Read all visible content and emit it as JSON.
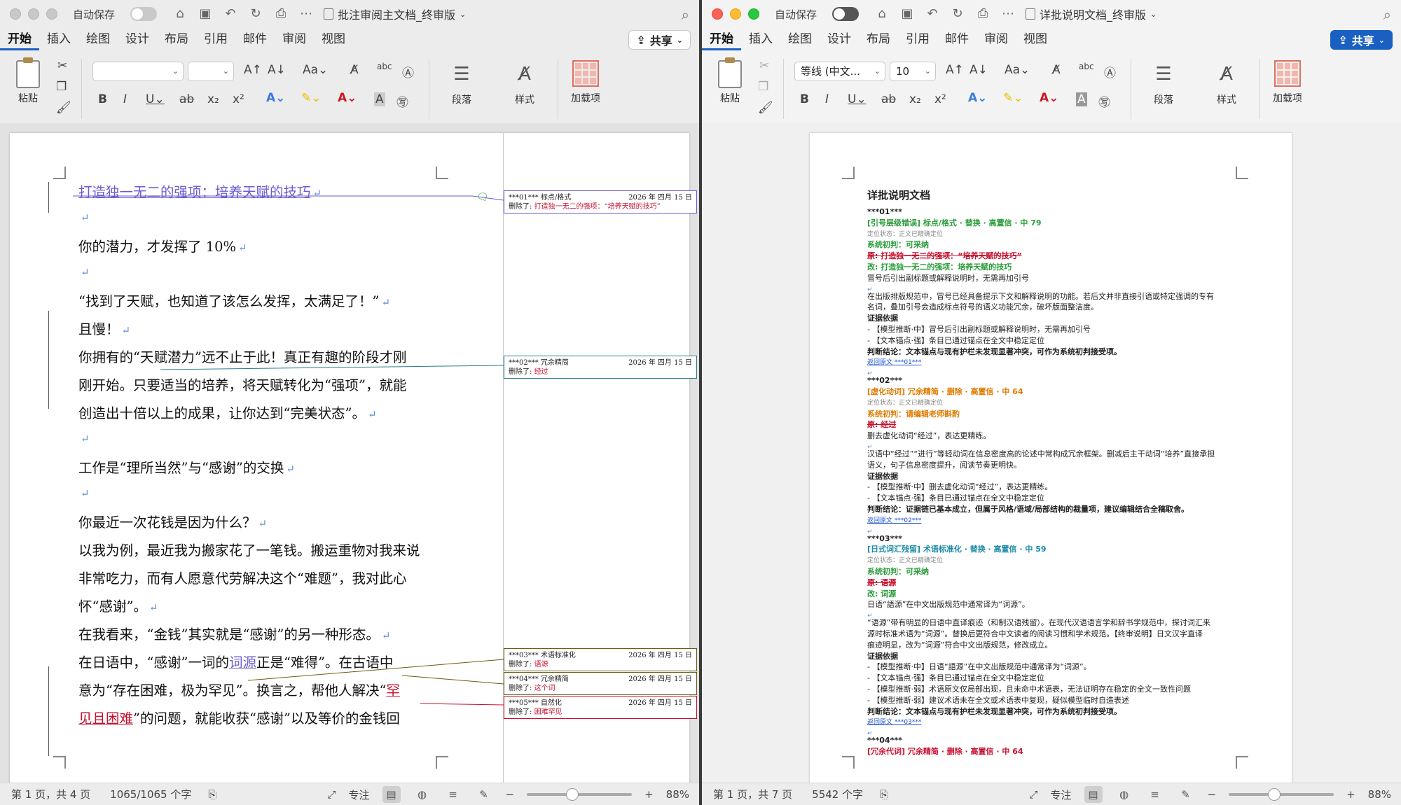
{
  "left": {
    "autosave_label": "自动保存",
    "title": "批注审阅主文档_终审版",
    "tabs": [
      "开始",
      "插入",
      "绘图",
      "设计",
      "布局",
      "引用",
      "邮件",
      "审阅",
      "视图"
    ],
    "share_label": "共享",
    "ribbon": {
      "paste": "粘贴",
      "paragraph": "段落",
      "styles": "样式",
      "addins": "加载项",
      "font_name": "",
      "font_size": ""
    },
    "paragraphs": [
      {
        "text": "打造独一无二的强项：培养天赋的技巧",
        "style": "ins"
      },
      {
        "text": ""
      },
      {
        "text": "你的潜力，才发挥了 10%"
      },
      {
        "text": ""
      },
      {
        "text": "“找到了天赋，也知道了该怎么发挥，太满足了！”"
      },
      {
        "text": "且慢！"
      },
      {
        "text": "你拥有的“天赋潜力”远不止于此！真正有趣的阶段才刚"
      },
      {
        "text": "刚开始。只要适当的培养，将天赋转化为“强项”，就能"
      },
      {
        "text": "创造出十倍以上的成果，让你达到“完美状态”。"
      },
      {
        "text": ""
      },
      {
        "text": "工作是“理所当然”与“感谢”的交换"
      },
      {
        "text": ""
      },
      {
        "text": "你最近一次花钱是因为什么？"
      },
      {
        "text": "以我为例，最近我为搬家花了一笔钱。搬运重物对我来说"
      },
      {
        "text": "非常吃力，而有人愿意代劳解决这个“难题”，我对此心"
      },
      {
        "text": "怀“感谢”。"
      },
      {
        "text": "在我看来，“金钱”其实就是“感谢”的另一种形态。"
      }
    ],
    "para_line17_a": "在日语中，“感谢”一词的",
    "para_line17_b": "词源",
    "para_line17_c": "正是“难得”。在古语中",
    "para_line18_a": "意为“存在困难，极为罕见”。换言之，帮他人解决“",
    "para_line18_b": "罕",
    "para_line19_a": "见且困难",
    "para_line19_b": "”的问题，就能收获“感谢”以及等价的金钱回",
    "comments": [
      {
        "id": "***01***",
        "type": "标点/格式",
        "date": "2026 年 四月 15 日",
        "deleted": "打造独一无二的强项：“培养天赋的技巧”"
      },
      {
        "id": "***02***",
        "type": "冗余精简",
        "date": "2026 年 四月 15 日",
        "deleted": "经过"
      },
      {
        "id": "***03***",
        "type": "术语标准化",
        "date": "2026 年 四月 15 日",
        "deleted": "语源"
      },
      {
        "id": "***04***",
        "type": "冗余精简",
        "date": "2026 年 四月 15 日",
        "deleted": "这个词"
      },
      {
        "id": "***05***",
        "type": "自然化",
        "date": "2026 年 四月 15 日",
        "deleted": "困难罕见"
      }
    ],
    "deleted_label": "删除了:",
    "status": {
      "page": "第 1 页，共 4 页",
      "words": "1065/1065 个字",
      "focus": "专注",
      "zoom": "88%"
    }
  },
  "right": {
    "autosave_label": "自动保存",
    "title": "详批说明文档_终审版",
    "tabs": [
      "开始",
      "插入",
      "绘图",
      "设计",
      "布局",
      "引用",
      "邮件",
      "审阅",
      "视图"
    ],
    "share_label": "共享",
    "ribbon": {
      "paste": "粘贴",
      "paragraph": "段落",
      "styles": "样式",
      "addins": "加载项",
      "font_name": "等线 (中文...",
      "font_size": "10"
    },
    "doc_title": "详批说明文档",
    "lines": [
      {
        "t": "***01***",
        "c": "bold"
      },
      {
        "t": "[引号层级错误] 标点/格式 · 替换 · 高置信 · 中 79",
        "c": "tag-g"
      },
      {
        "t": "定位状态：正文已精确定位",
        "c": "dim"
      },
      {
        "t": "系统初判：可采纳",
        "c": "g-bold"
      },
      {
        "t": "原: 打造独一无二的强项：“培养天赋的技巧”",
        "c": "orig-r"
      },
      {
        "t": "改: 打造独一无二的强项：培养天赋的技巧",
        "c": "new-g"
      },
      {
        "t": "冒号后引出副标题或解释说明时，无需再加引号",
        "c": ""
      },
      {
        "t": "",
        "c": ""
      },
      {
        "t": "在出版排版规范中，冒号已经具备提示下文和解释说明的功能。若后文并非直接引语或特定强调的专有",
        "c": ""
      },
      {
        "t": "名词，叠加引号会造成标点符号的语义功能冗余，破坏版面整洁度。",
        "c": ""
      },
      {
        "t": "证据依据",
        "c": "bold"
      },
      {
        "t": "- 【模型推断·中】冒号后引出副标题或解释说明时，无需再加引号",
        "c": ""
      },
      {
        "t": "- 【文本锚点·强】条目已通过锚点在全文中稳定定位",
        "c": ""
      },
      {
        "t": "判断结论：文本锚点与现有护栏未发现显著冲突，可作为系统初判接受项。",
        "c": "bold-lead"
      },
      {
        "t": "返回原文 ***01***",
        "c": "link"
      },
      {
        "t": "",
        "c": ""
      },
      {
        "t": "***02***",
        "c": "bold"
      },
      {
        "t": "[虚化动词] 冗余精简 · 删除 · 高置信 · 中 64",
        "c": "tag-o"
      },
      {
        "t": "定位状态：正文已精确定位",
        "c": "dim"
      },
      {
        "t": "系统初判：请编辑老师斟酌",
        "c": "o-bold"
      },
      {
        "t": "原: 经过",
        "c": "orig-r"
      },
      {
        "t": "删去虚化动词“经过”，表达更精练。",
        "c": ""
      },
      {
        "t": "",
        "c": ""
      },
      {
        "t": "汉语中“经过”“进行”等轻动词在信息密度高的论述中常构成冗余框架。删减后主干动词“培养”直接承担",
        "c": ""
      },
      {
        "t": "语义，句子信息密度提升，阅读节奏更明快。",
        "c": ""
      },
      {
        "t": "证据依据",
        "c": "bold"
      },
      {
        "t": "- 【模型推断·中】删去虚化动词“经过”，表达更精练。",
        "c": ""
      },
      {
        "t": "- 【文本锚点·强】条目已通过锚点在全文中稳定定位",
        "c": ""
      },
      {
        "t": "判断结论：证据链已基本成立，但属于风格/语域/局部结构的裁量项，建议编辑结合全稿取舍。",
        "c": "bold-lead"
      },
      {
        "t": "返回原文 ***02***",
        "c": "link"
      },
      {
        "t": "",
        "c": ""
      },
      {
        "t": "***03***",
        "c": "bold"
      },
      {
        "t": "[日式词汇残留] 术语标准化 · 替换 · 高置信 · 中 59",
        "c": "tag-b"
      },
      {
        "t": "定位状态：正文已精确定位",
        "c": "dim"
      },
      {
        "t": "系统初判：可采纳",
        "c": "g-bold"
      },
      {
        "t": "原: 语源",
        "c": "orig-r"
      },
      {
        "t": "改: 词源",
        "c": "new-g"
      },
      {
        "t": "日语“語源”在中文出版规范中通常译为“词源”。",
        "c": ""
      },
      {
        "t": "",
        "c": ""
      },
      {
        "t": "“语源”带有明显的日语中直译痕迹（和制汉语残留）。在现代汉语语言学和辞书学规范中，探讨词汇来",
        "c": ""
      },
      {
        "t": "源时标准术语为“词源”。替换后更符合中文读者的阅读习惯和学术规范。【终审说明】日文汉字直译",
        "c": ""
      },
      {
        "t": "痕迹明显，改为“词源”符合中文出版规范，修改成立。",
        "c": ""
      },
      {
        "t": "证据依据",
        "c": "bold"
      },
      {
        "t": "- 【模型推断·中】日语“語源”在中文出版规范中通常译为“词源”。",
        "c": ""
      },
      {
        "t": "- 【文本锚点·强】条目已通过锚点在全文中稳定定位",
        "c": ""
      },
      {
        "t": "- 【模型推断·弱】术语原文仅局部出现，且未命中术语表，无法证明存在稳定的全文一致性问题",
        "c": ""
      },
      {
        "t": "- 【模型推断·弱】建议术语未在全文或术语表中复现，疑似模型临时自造表述",
        "c": ""
      },
      {
        "t": "判断结论：文本锚点与现有护栏未发现显著冲突，可作为系统初判接受项。",
        "c": "bold-lead"
      },
      {
        "t": "返回原文 ***03***",
        "c": "link"
      },
      {
        "t": "",
        "c": ""
      },
      {
        "t": "***04***",
        "c": "bold"
      },
      {
        "t": "[冗余代词] 冗余精简 · 删除 · 高置信 · 中 64",
        "c": "tag-r"
      }
    ],
    "status": {
      "page": "第 1 页，共 7 页",
      "words": "5542 个字",
      "focus": "专注",
      "zoom": "88%"
    }
  }
}
